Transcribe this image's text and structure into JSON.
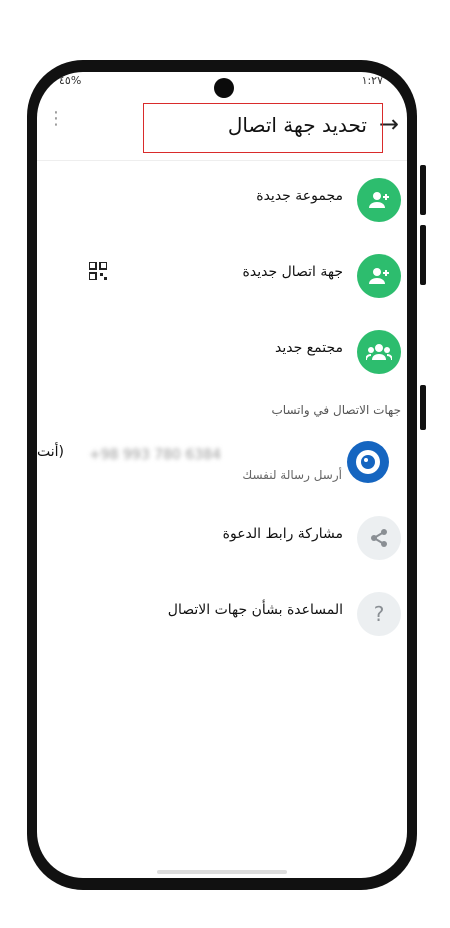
{
  "status_bar": {
    "left": "%٤٥",
    "right": "١:٢٧"
  },
  "appbar": {
    "title": "تحديد جهة اتصال",
    "back_icon": "arrow-right-icon",
    "menu_icon": "more-vertical-icon"
  },
  "actions": [
    {
      "label": "مجموعة جديدة",
      "icon": "group-add-icon",
      "highlighted": true
    },
    {
      "label": "جهة اتصال جديدة",
      "icon": "person-add-icon",
      "extra_icon": "qr-code-icon"
    },
    {
      "label": "مجتمع جديد",
      "icon": "community-icon"
    }
  ],
  "section_title": "جهات الاتصال في واتساب",
  "self_contact": {
    "number": "+98 993 780 6384",
    "you_label": "(أنت",
    "subtitle": "أرسل رسالة لنفسك"
  },
  "footer_actions": [
    {
      "label": "مشاركة رابط الدعوة",
      "icon": "share-icon"
    },
    {
      "label": "المساعدة بشأن جهات الاتصال",
      "icon": "help-icon",
      "glyph": "?"
    }
  ],
  "colors": {
    "accent": "#2dbd6e",
    "highlight": "#d92b2b"
  }
}
